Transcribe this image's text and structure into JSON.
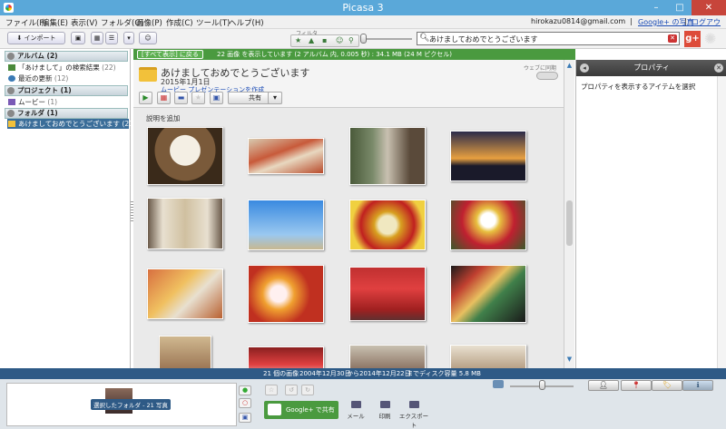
{
  "window": {
    "title": "Picasa 3",
    "minimize": "–",
    "maximize": "□",
    "close": "✕"
  },
  "menu": {
    "items": [
      "ファイル(F)",
      "編集(E)",
      "表示(V)",
      "フォルダ(O)",
      "画像(P)",
      "作成(C)",
      "ツール(T)",
      "ヘルプ(H)"
    ],
    "account": "hirokazu0814@gmail.com",
    "sep": "|",
    "gplus_photos": "Google+ の写真",
    "logout": "ログアウト"
  },
  "toolbar": {
    "import_label": "インポート",
    "filter_label": "フィルタ",
    "search_value": "あけましておめでとうございます"
  },
  "left_panel": {
    "sections": [
      {
        "title": "アルバム (2)",
        "items": [
          {
            "label": "「あけまして」の検索結果",
            "count": "(22)"
          },
          {
            "label": "最近の更新",
            "count": "(12)"
          }
        ]
      },
      {
        "title": "プロジェクト (1)",
        "items": [
          {
            "label": "ムービー",
            "count": "(1)"
          }
        ]
      },
      {
        "title": "フォルダ (1)",
        "items": [
          {
            "label": "あけましておめでとうございます",
            "count": "(21)"
          }
        ]
      }
    ]
  },
  "center": {
    "back_button": "[すべて表示] に戻る",
    "status": "22 画像 を表示しています (2 アルバム 内, 0.005 秒) : 34.1 MB (24 M ピクセル)",
    "folder_title": "あけましておめでとうございます",
    "folder_date": "2015年1月1日",
    "folder_link": "ムービー プレゼンテーションを作成",
    "web_sync": "ウェブに同期",
    "share_button": "共有",
    "description": "説明を追加"
  },
  "right_panel": {
    "title": "プロパティ",
    "message": "プロパティを表示するアイテムを選択"
  },
  "status_bar": {
    "count": "21 個の画像",
    "date_from": "2004年12月30日",
    "from_label": "から",
    "date_to": "2014年12月22日",
    "disk_label": "までディスク容量 5.8 MB"
  },
  "bottom": {
    "tray_label": "選択したフォルダ - 21 写真",
    "share_button": "Google+ で共有",
    "email": "メール",
    "print": "印刷",
    "export": "エクスポート"
  }
}
